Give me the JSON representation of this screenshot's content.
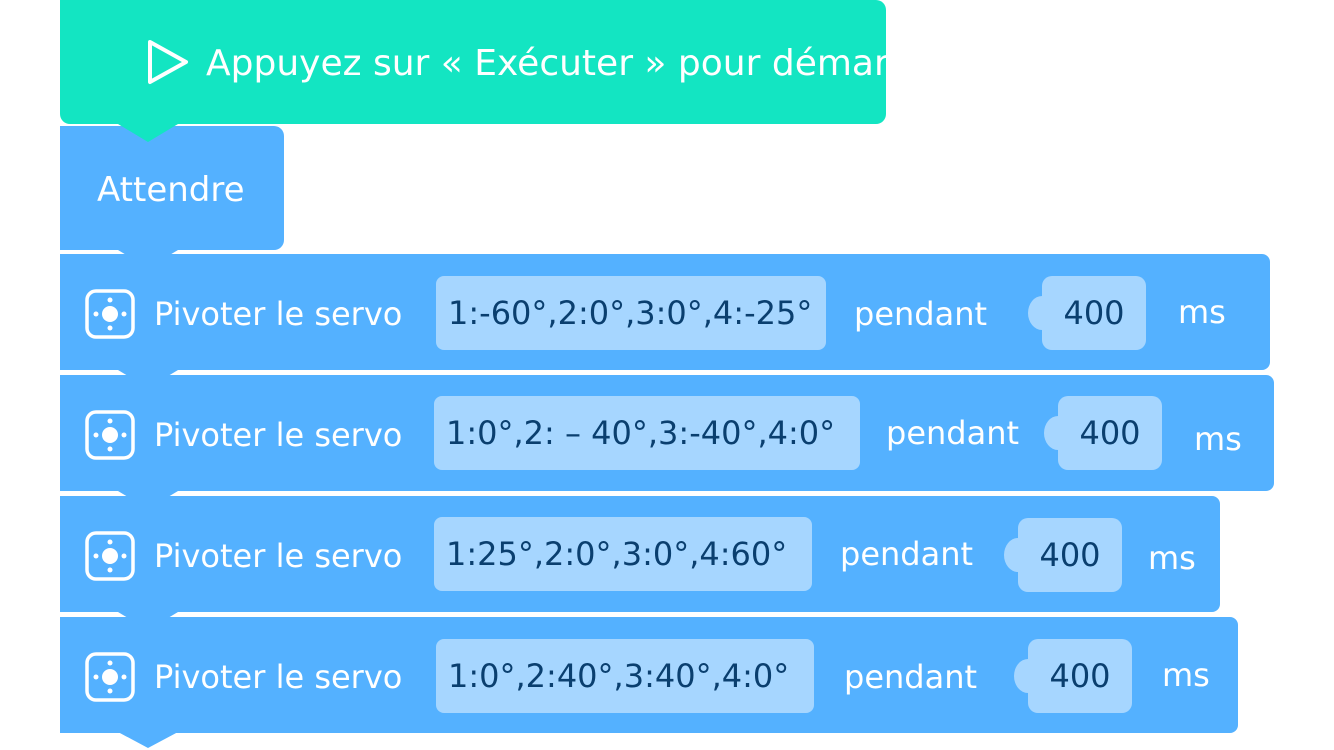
{
  "start_block": {
    "icon": "play-icon",
    "label": "Appuyez sur « Exécuter » pour démarrer",
    "color": "#13e5c2"
  },
  "wait_block": {
    "label": "Attendre",
    "color": "#54b1ff"
  },
  "servo_blocks": [
    {
      "label": "Pivoter le servo",
      "angles": "1:-60°,2:0°,3:0°,4:-25°",
      "pendant": "pendant",
      "duration": "400",
      "unit": "ms"
    },
    {
      "label": "Pivoter le servo",
      "angles": "1:0°,2: – 40°,3:-40°,4:0°",
      "pendant": "pendant",
      "duration": "400",
      "unit": "ms"
    },
    {
      "label": "Pivoter le servo",
      "angles": "1:25°,2:0°,3:0°,4:60°",
      "pendant": "pendant",
      "duration": "400",
      "unit": "ms"
    },
    {
      "label": "Pivoter le servo",
      "angles": "1:0°,2:40°,3:40°,4:0°",
      "pendant": "pendant",
      "duration": "400",
      "unit": "ms"
    }
  ],
  "colors": {
    "block_blue": "#54b1ff",
    "field_blue": "#a6d6ff",
    "field_text": "#0a3f6f"
  }
}
